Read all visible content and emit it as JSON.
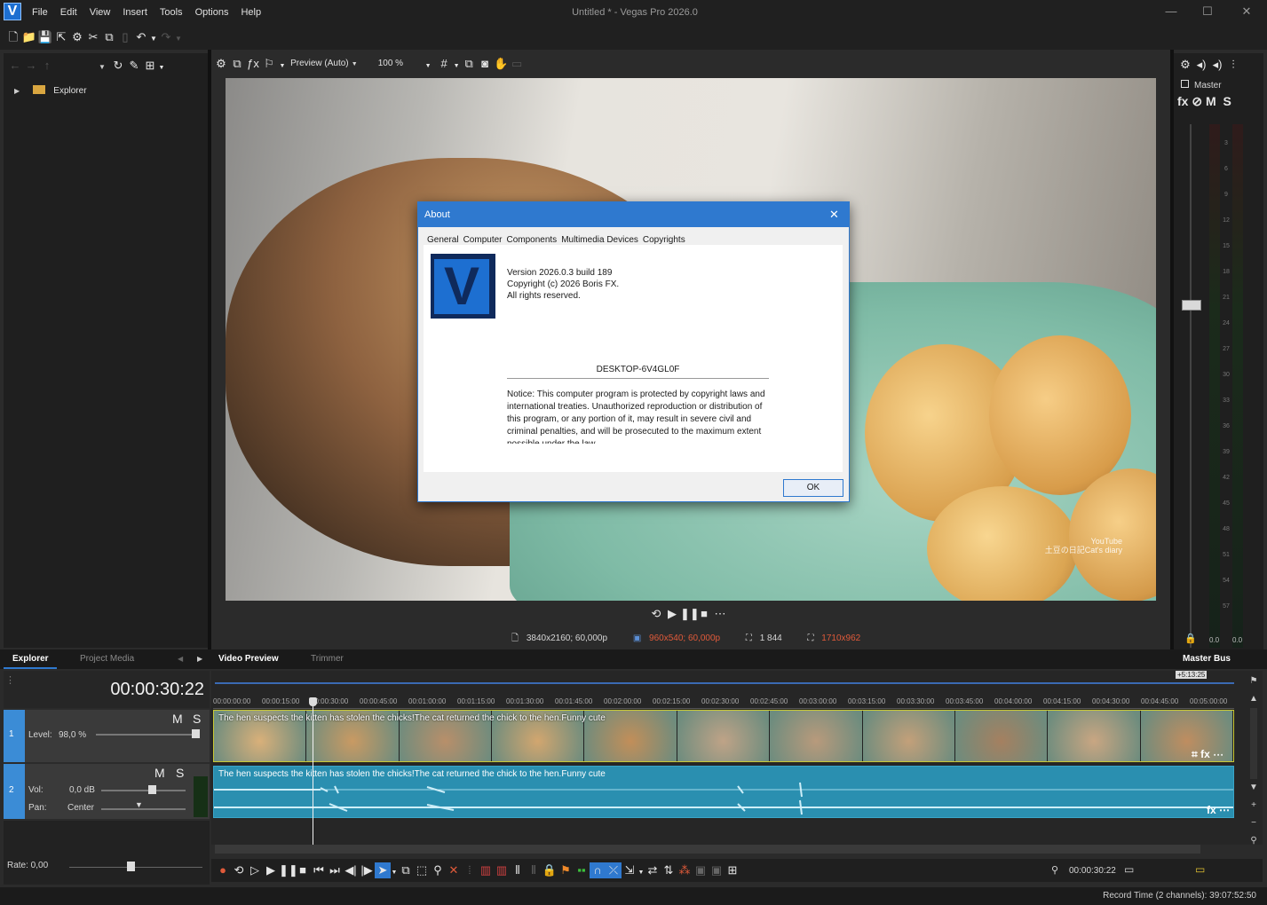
{
  "app": {
    "title": "Untitled * - Vegas Pro 2026.0",
    "logo_letter": "V",
    "menu": [
      "File",
      "Edit",
      "View",
      "Insert",
      "Tools",
      "Options",
      "Help"
    ]
  },
  "explorer": {
    "tree_item": "Explorer",
    "tabs": [
      "Explorer",
      "Project Media"
    ]
  },
  "preview": {
    "mode_label": "Preview (Auto)",
    "zoom_label": "100 %",
    "project_info": "3840x2160; 60,000p",
    "preview_info": "960x540; 60,000p",
    "frame_number": "1 844",
    "display_size": "1710x962",
    "tabs": [
      "Video Preview",
      "Trimmer"
    ],
    "watermark_line1": "YouTube",
    "watermark_line2": "土豆の日記Cat's diary"
  },
  "about": {
    "title": "About",
    "tabs": [
      "General",
      "Computer",
      "Components",
      "Multimedia Devices",
      "Copyrights"
    ],
    "version": "Version 2026.0.3 build 189",
    "copyright": "Copyright (c) 2026 Boris FX.",
    "rights": "All rights reserved.",
    "machine": "DESKTOP-6V4GL0F",
    "notice": "Notice: This computer program is protected by copyright laws and international treaties. Unauthorized reproduction or distribution of this program, or any portion of it, may result in severe civil and criminal penalties, and will be prosecuted to the maximum extent possible under the law.",
    "ok": "OK"
  },
  "mixer": {
    "master": "Master",
    "fx": "fx",
    "m": "M",
    "s": "S",
    "scale": [
      "3",
      "6",
      "9",
      "12",
      "15",
      "18",
      "21",
      "24",
      "27",
      "30",
      "33",
      "36",
      "39",
      "42",
      "45",
      "48",
      "51",
      "54",
      "57"
    ],
    "peak_left": "0.0",
    "peak_right": "0.0",
    "tab": "Master Bus"
  },
  "timeline": {
    "timecode": "00:00:30:22",
    "duration_badge": "+5:13:25",
    "ruler": [
      "00:00:00:00",
      "00:00:15:00",
      "00:00:30:00",
      "00:00:45:00",
      "00:01:00:00",
      "00:01:15:00",
      "00:01:30:00",
      "00:01:45:00",
      "00:02:00:00",
      "00:02:15:00",
      "00:02:30:00",
      "00:02:45:00",
      "00:03:00:00",
      "00:03:15:00",
      "00:03:30:00",
      "00:03:45:00",
      "00:04:00:00",
      "00:04:15:00",
      "00:04:30:00",
      "00:04:45:00",
      "00:05:00:00"
    ],
    "video_track": {
      "number": "1",
      "level_label": "Level:",
      "level_value": "98,0 %",
      "m": "M",
      "s": "S"
    },
    "audio_track": {
      "number": "2",
      "vol_label": "Vol:",
      "vol_value": "0,0 dB",
      "pan_label": "Pan:",
      "pan_value": "Center",
      "m": "M",
      "s": "S"
    },
    "clip_title": "The hen suspects the kitten has stolen the chicks!The cat returned the chick to the hen.Funny cute",
    "rate": "Rate: 0,00",
    "cursor_time": "00:00:30:22",
    "record_time": "Record Time (2 channels): 39:07:52:50"
  },
  "colors": {
    "accent": "#2f79cf",
    "warning_text": "#e05a3a",
    "audio_clip": "#2a8fb0",
    "video_border": "#c9c934"
  }
}
